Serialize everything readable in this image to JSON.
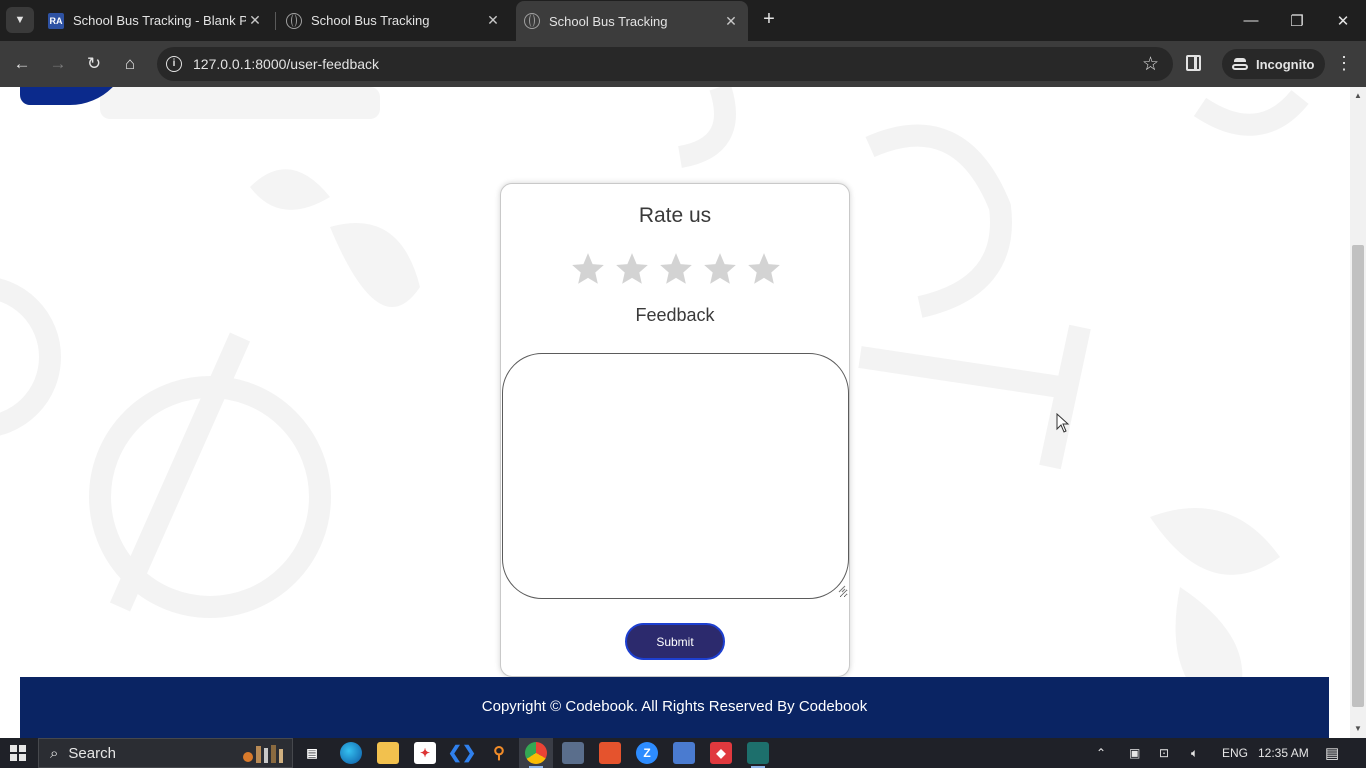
{
  "browser": {
    "tabs": [
      {
        "title": "School Bus Tracking - Blank Pa",
        "favicon": "RA",
        "active": false
      },
      {
        "title": "School Bus Tracking",
        "favicon": "globe-icon",
        "active": false
      },
      {
        "title": "School Bus Tracking",
        "favicon": "globe-icon",
        "active": true
      }
    ],
    "url": "127.0.0.1:8000/user-feedback",
    "incognito_label": "Incognito"
  },
  "page": {
    "rating": {
      "heading": "Rate us",
      "star_count": 5,
      "selected": 0,
      "star_color": "#d3d3d3"
    },
    "feedback": {
      "label": "Feedback",
      "value": ""
    },
    "submit_label": "Submit",
    "footer_text": "Copyright © Codebook. All Rights Reserved By Codebook",
    "colors": {
      "footer_bg": "#0a2463",
      "submit_bg": "#2c2a6d",
      "submit_border": "#1d3fd0",
      "header_accent": "#0b2a8c"
    }
  },
  "taskbar": {
    "search_placeholder": "Search",
    "language": "ENG",
    "time": "12:35 AM"
  }
}
